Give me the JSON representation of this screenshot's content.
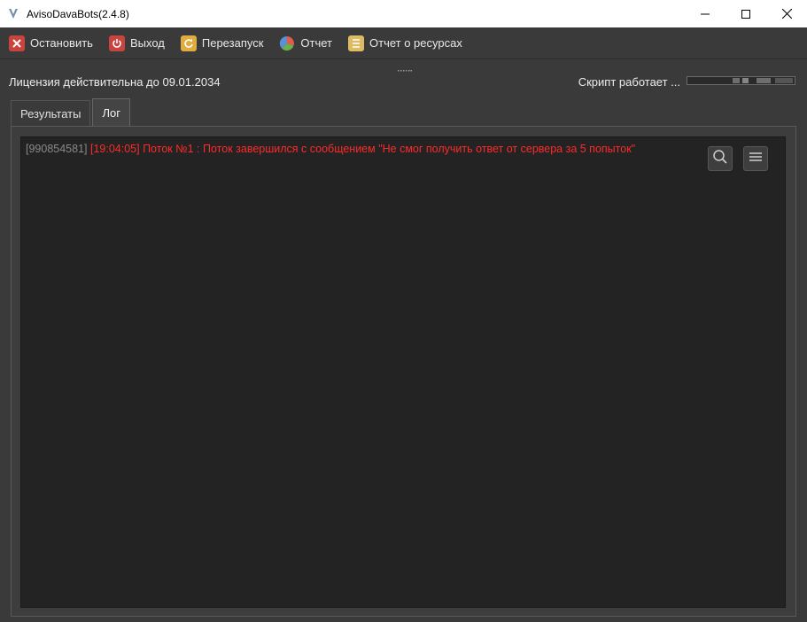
{
  "window": {
    "title": "AvisoDavaBots(2.4.8)",
    "minimize_glyph": "—",
    "maximize_glyph": "☐",
    "close_glyph": "✕"
  },
  "toolbar": {
    "items": [
      {
        "label": "Остановить",
        "icon": "stop-icon",
        "color": "#d9534f"
      },
      {
        "label": "Выход",
        "icon": "power-icon",
        "color": "#d9534f"
      },
      {
        "label": "Перезапуск",
        "icon": "restart-icon",
        "color": "#e8b54a"
      },
      {
        "label": "Отчет",
        "icon": "pie-chart-icon",
        "color": "#5b9bd5"
      },
      {
        "label": "Отчет о ресурсах",
        "icon": "list-icon",
        "color": "#e8c46a"
      }
    ]
  },
  "status": {
    "license": "Лицензия действительна до 09.01.2034",
    "script": "Скрипт работает ..."
  },
  "tabs": [
    {
      "label": "Результаты",
      "active": false
    },
    {
      "label": "Лог",
      "active": true
    }
  ],
  "log": {
    "lines": [
      {
        "id": "[990854581]",
        "message": "[19:04:05] Поток №1 : Поток завершился с сообщением \"Не смог получить ответ от сервера за 5 попыток\""
      }
    ]
  },
  "colors": {
    "background": "#3a3a3a",
    "log_background": "#232323",
    "error_text": "#ff2a2a"
  }
}
